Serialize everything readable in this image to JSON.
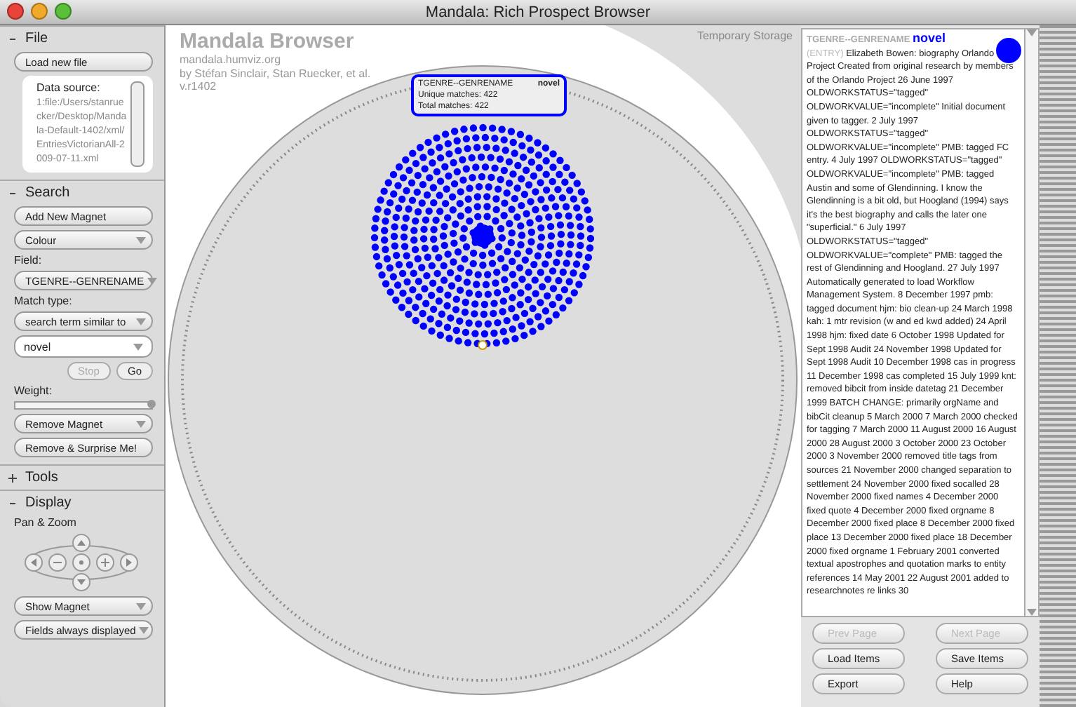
{
  "window": {
    "title": "Mandala: Rich Prospect Browser"
  },
  "sidebar": {
    "sections": [
      {
        "title": "File",
        "expanded": true,
        "kind": "file"
      },
      {
        "title": "Search",
        "expanded": true,
        "kind": "search"
      },
      {
        "title": "Tools",
        "expanded": false,
        "kind": "tools"
      },
      {
        "title": "Display",
        "expanded": true,
        "kind": "display"
      }
    ],
    "file": {
      "load_button": "Load new file",
      "data_source_label": "Data source:",
      "data_source_path": "1:file:/Users/stanruecker/Desktop/Mandala-Default-1402/xml/EntriesVictorianAll-2009-07-11.xml"
    },
    "search": {
      "add_button": "Add New Magnet",
      "colour_select": "Colour",
      "field_label": "Field:",
      "field_select": "TGENRE--GENRENAME",
      "match_label": "Match type:",
      "match_select": "search term similar to",
      "term": "novel",
      "stop_button": "Stop",
      "stop_disabled": true,
      "go_button": "Go",
      "weight_label": "Weight:",
      "weight": {
        "level": 1.0
      },
      "remove_select": "Remove Magnet",
      "surprise_button": "Remove & Surprise Me!"
    },
    "display": {
      "pan_zoom_label": "Pan & Zoom",
      "show_magnet_select": "Show Magnet",
      "fields_select": "Fields always displayed"
    }
  },
  "canvas": {
    "title": "Mandala Browser",
    "url": "mandala.humviz.org",
    "authors": "by Stéfan Sinclair, Stan Ruecker, et al.",
    "version": "v.r1402",
    "storage_label": "Temporary Storage",
    "magnet": {
      "field": "TGENRE--GENRENAME",
      "term": "novel",
      "unique": "Unique matches: 422",
      "total": "Total matches: 422",
      "color": "#0000ff"
    }
  },
  "detail": {
    "field_label": "TGENRE--GENRENAME",
    "field_value": "novel",
    "entry_label": "(ENTRY)",
    "text": "Elizabeth Bowen: biography Orlando Project Created from original research by members of the Orlando Project 26 June 1997 OLDWORKSTATUS=\"tagged\" OLDWORKVALUE=\"incomplete\" Initial document given to tagger. 2 July 1997 OLDWORKSTATUS=\"tagged\" OLDWORKVALUE=\"incomplete\" PMB: tagged FC entry. 4 July 1997 OLDWORKSTATUS=\"tagged\" OLDWORKVALUE=\"incomplete\" PMB: tagged Austin and some of Glendinning. I know the Glendinning is a bit old, but Hoogland (1994) says it's the best biography and calls the later one \"superficial.\" 6 July 1997 OLDWORKSTATUS=\"tagged\" OLDWORKVALUE=\"complete\" PMB: tagged the rest of Glendinning and Hoogland. 27 July 1997 Automatically generated to load Workflow Management System. 8 December 1997 pmb: tagged document hjm: bio clean-up 24 March 1998 kah: 1 mtr revision (w and ed kwd added) 24 April 1998 hjm: fixed date 6 October 1998 Updated for Sept 1998 Audit 24 November 1998 Updated for Sept 1998 Audit 10 December 1998 cas in progress 11 December 1998 cas completed 15 July 1999 knt: removed bibcit from inside datetag 21 December 1999 BATCH CHANGE: primarily orgName and bibCit cleanup 5 March 2000 7 March 2000 checked for tagging 7 March 2000 11 August 2000 16 August 2000 28 August 2000 3 October 2000 23 October 2000 3 November 2000 removed title tags from sources 21 November 2000 changed separation to settlement 24 November 2000 fixed socalled 28 November 2000 fixed names 4 December 2000 fixed quote 4 December 2000 fixed orgname 8 December 2000 fixed place 8 December 2000 fixed place 13 December 2000 fixed place 18 December 2000 fixed orgname 1 February 2001 converted textual apostrophes and quotation marks to entity references 14 May 2001 22 August 2001 added to researchnotes re links 30",
    "color": "#0000ff"
  },
  "buttons": [
    {
      "label": "Prev Page",
      "disabled": true
    },
    {
      "label": "Next Page",
      "disabled": true
    },
    {
      "label": "Load Items",
      "disabled": false
    },
    {
      "label": "Save Items",
      "disabled": false
    },
    {
      "label": "Export",
      "disabled": false
    },
    {
      "label": "Help",
      "disabled": false
    }
  ]
}
